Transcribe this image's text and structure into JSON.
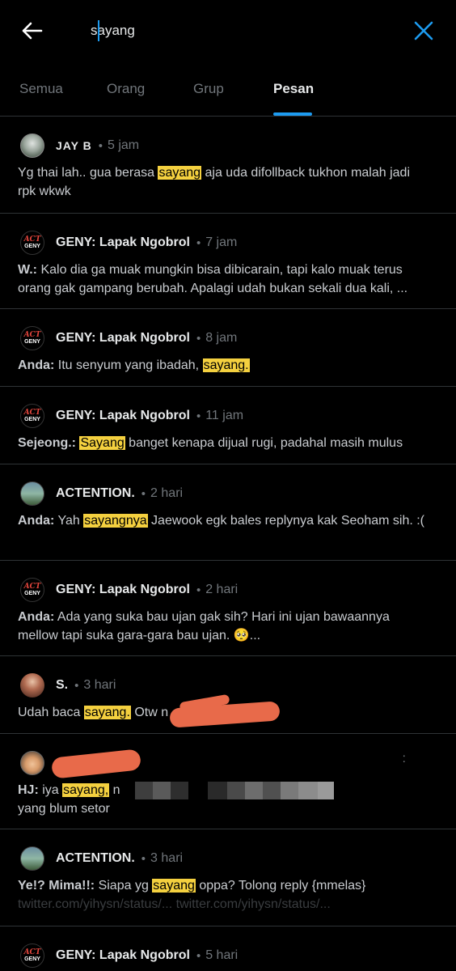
{
  "search": {
    "value": "sayang"
  },
  "tabs": [
    {
      "label": "Semua"
    },
    {
      "label": "Orang"
    },
    {
      "label": "Grup"
    },
    {
      "label": "Pesan"
    }
  ],
  "active_tab": "Pesan",
  "messages": [
    {
      "name": "JAY B",
      "time": "5 jam",
      "pre": "Yg thai lah.. gua berasa ",
      "hl": "sayang",
      "post": " aja uda difollback tukhon malah jadi rpk wkwk"
    },
    {
      "name": "GENY: Lapak Ngobrol",
      "time": "7 jam",
      "who": "W.:",
      "text": "Kalo dia ga muak mungkin bisa dibicarain, tapi kalo muak terus orang gak gampang berubah. Apalagi udah bukan sekali dua kali, ..."
    },
    {
      "name": "GENY: Lapak Ngobrol",
      "time": "8 jam",
      "who": "Anda:",
      "pre": "Itu senyum yang ibadah, ",
      "hl": "sayang."
    },
    {
      "name": "GENY: Lapak Ngobrol",
      "time": "11 jam",
      "who": "Sejeong.:",
      "hl": "Sayang",
      "post": " banget kenapa dijual rugi, padahal masih mulus"
    },
    {
      "name": "ACTENTION.",
      "time": "2 hari",
      "who": "Anda:",
      "pre": "Yah ",
      "hl": "sayangnya",
      "post": " Jaewook egk bales replynya kak Seoham sih. :("
    },
    {
      "name": "GENY: Lapak Ngobrol",
      "time": "2 hari",
      "who": "Anda:",
      "text": "Ada yang suka bau ujan gak sih? Hari ini ujan bawaannya mellow tapi suka gara-gara bau ujan. 🥺..."
    },
    {
      "name": "S.",
      "time": "3 hari",
      "pre": "Udah baca ",
      "hl": "sayang.",
      "post": " Otw n"
    },
    {
      "who": "HJ:",
      "pre": "iya ",
      "hl": "sayang,",
      "post": " n",
      "line2": "yang blum setor",
      "menu": ":"
    },
    {
      "name": "ACTENTION.",
      "time": "3 hari",
      "who": "Ye!? Mima!!:",
      "pre": "Siapa yg ",
      "hl": "sayang",
      "post": " oppa? Tolong reply {mmelas}",
      "link": "twitter.com/yihysn/status/... twitter.com/yihysn/status/..."
    },
    {
      "name": "GENY: Lapak Ngobrol",
      "time": "5 hari"
    }
  ],
  "avatar_text": {
    "act": "ACT",
    "geny": "GENY"
  },
  "separator": "•",
  "colors": {
    "accent": "#1d9bf0",
    "highlight": "#f4d03f",
    "redaction": "#e86a4a"
  },
  "icons": {
    "back": "arrow-left-icon",
    "close": "close-x-icon"
  }
}
